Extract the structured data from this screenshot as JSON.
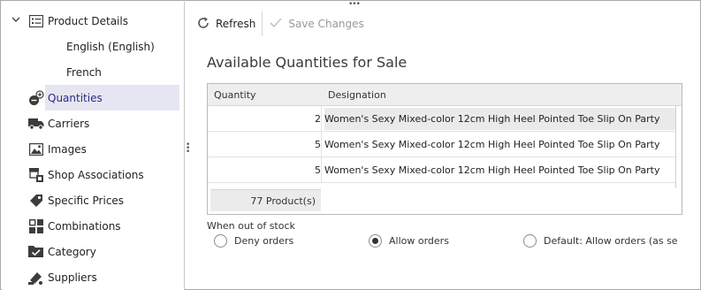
{
  "sidebar": {
    "items": [
      {
        "label": "Product Details",
        "icon": "list-icon",
        "expanded": true
      },
      {
        "label": "English (English)",
        "icon": null
      },
      {
        "label": "French",
        "icon": null
      },
      {
        "label": "Quantities",
        "icon": "quantities-icon",
        "selected": true
      },
      {
        "label": "Carriers",
        "icon": "truck-icon"
      },
      {
        "label": "Images",
        "icon": "image-icon"
      },
      {
        "label": "Shop Associations",
        "icon": "shop-associations-icon"
      },
      {
        "label": "Specific Prices",
        "icon": "tag-icon"
      },
      {
        "label": "Combinations",
        "icon": "combinations-icon"
      },
      {
        "label": "Category",
        "icon": "folder-check-icon"
      },
      {
        "label": "Suppliers",
        "icon": "suppliers-icon"
      }
    ]
  },
  "toolbar": {
    "refresh_label": "Refresh",
    "save_label": "Save Changes"
  },
  "section_title": "Available Quantities for Sale",
  "grid": {
    "columns": [
      "Quantity",
      "Designation"
    ],
    "rows": [
      {
        "quantity": "2",
        "designation": "Women's Sexy Mixed-color 12cm High Heel Pointed Toe Slip On Party"
      },
      {
        "quantity": "5",
        "designation": "Women's Sexy Mixed-color 12cm High Heel Pointed Toe Slip On Party"
      },
      {
        "quantity": "5",
        "designation": "Women's Sexy Mixed-color 12cm High Heel Pointed Toe Slip On Party"
      }
    ],
    "footer_count": "77 Product(s)"
  },
  "out_of_stock": {
    "label": "When out of stock",
    "options": [
      {
        "label": "Deny orders",
        "checked": false
      },
      {
        "label": "Allow orders",
        "checked": true
      },
      {
        "label": "Default: Allow orders (as set in",
        "checked": false
      }
    ]
  },
  "colors": {
    "selected_bg": "#e6e6f2",
    "selected_text": "#2b2a83",
    "icon": "#3c3c3c"
  }
}
